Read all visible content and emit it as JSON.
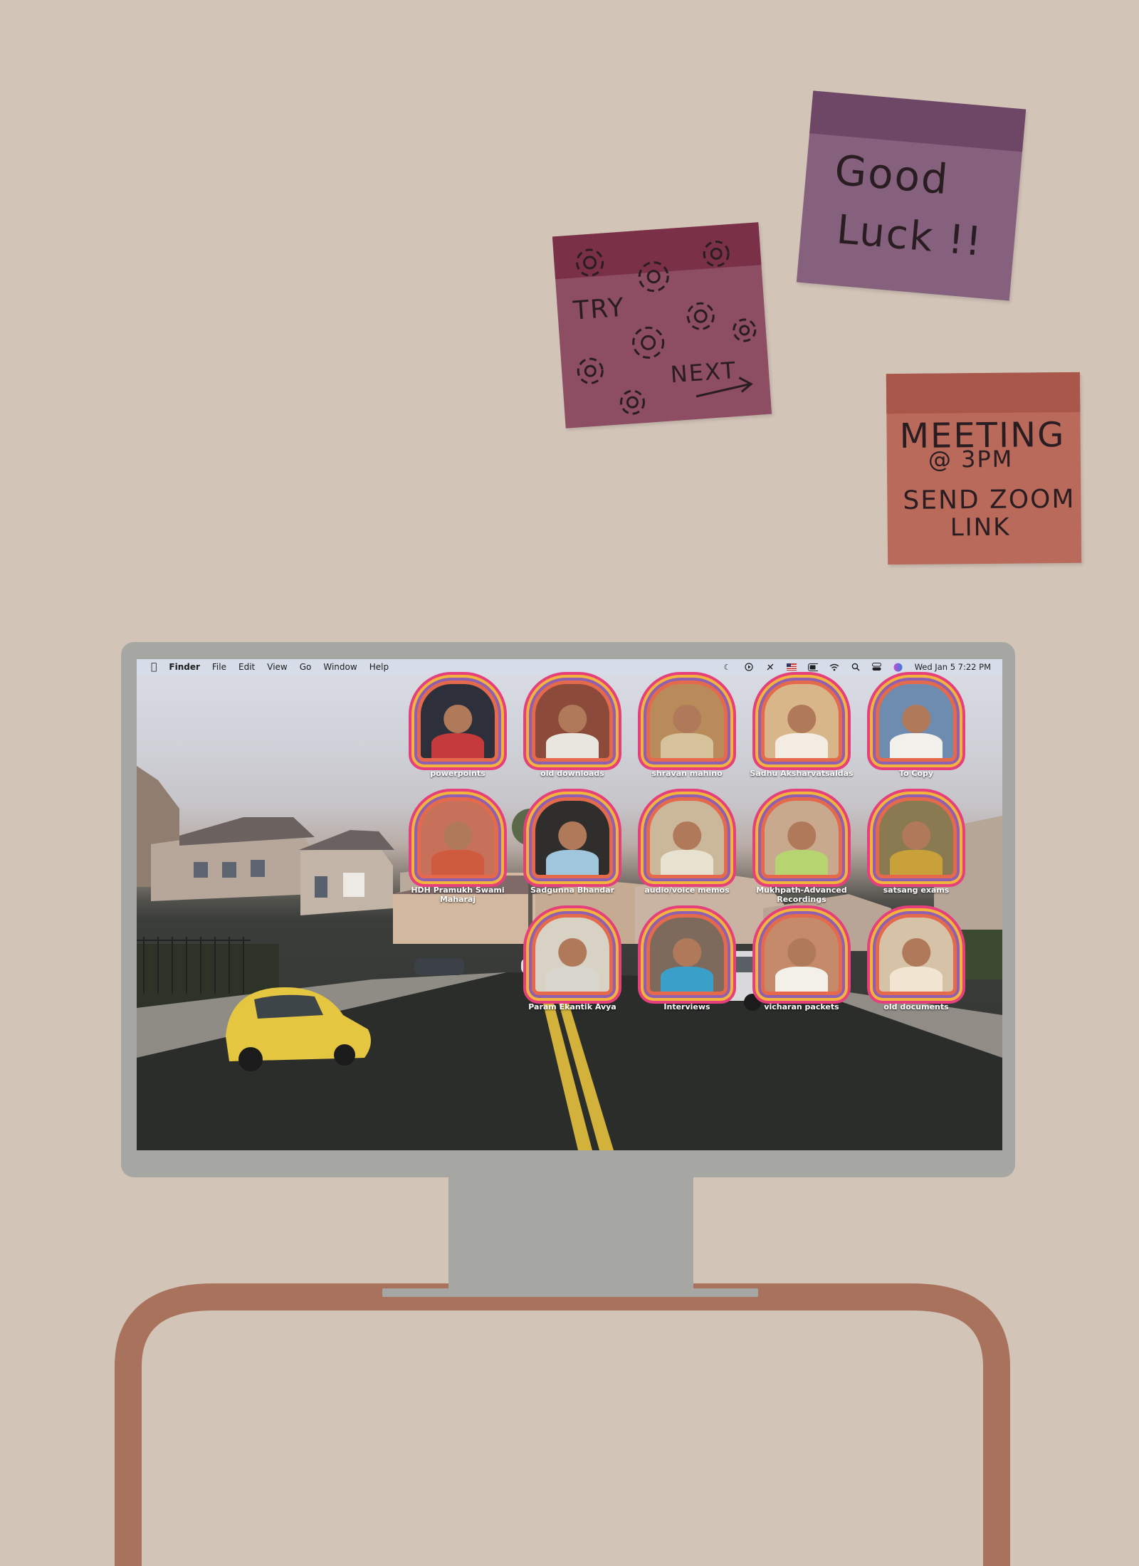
{
  "notes": {
    "try": {
      "line1": "TRY",
      "line2": "NEXT"
    },
    "luck": {
      "line1": "Good",
      "line2": "Luck !!"
    },
    "meeting": {
      "line1": "MEETING",
      "line2": "@ 3PM",
      "line3": "SEND ZOOM",
      "line4": "LINK"
    }
  },
  "menubar": {
    "apple_icon": "apple-logo-icon",
    "app_name": "Finder",
    "menus": [
      "File",
      "Edit",
      "View",
      "Go",
      "Window",
      "Help"
    ],
    "status_icons": [
      "moon-icon",
      "play-icon",
      "tool-icon",
      "us-flag-icon",
      "battery-icon",
      "wifi-icon",
      "search-icon",
      "control-center-icon",
      "siri-icon"
    ],
    "clock": "Wed Jan 5  7:22 PM"
  },
  "desktop_icons": [
    {
      "label": "powerpoints",
      "bg": "#2d2f3a",
      "shirt": "#c53b3b"
    },
    {
      "label": "old downloads",
      "bg": "#8b4a3a",
      "shirt": "#e8e6df"
    },
    {
      "label": "shravan mahino",
      "bg": "#b98a5a",
      "shirt": "#d5c29a"
    },
    {
      "label": "Sadhu Aksharvatsaldas",
      "bg": "#d9b58a",
      "shirt": "#f3ece2"
    },
    {
      "label": "To Copy",
      "bg": "#6e8bb0",
      "shirt": "#f2f0ea"
    },
    {
      "label": "HDH Pramukh Swami Maharaj",
      "bg": "#c8715a",
      "shirt": "#cf5b3e"
    },
    {
      "label": "Sadgunna Bhandar",
      "bg": "#2f2e2c",
      "shirt": "#9fc6dd"
    },
    {
      "label": "audio/voice memos",
      "bg": "#cbb79a",
      "shirt": "#e7e2cf"
    },
    {
      "label": "Mukhpath-Advanced Recordings",
      "bg": "#c9a98e",
      "shirt": "#b6d46f"
    },
    {
      "label": "satsang exams",
      "bg": "#8a7a52",
      "shirt": "#c9a13a"
    },
    {
      "label": "Param Ekantik Avya",
      "bg": "#d7d2c4",
      "shirt": "#d9d6cf"
    },
    {
      "label": "Interviews",
      "bg": "#7d6a5c",
      "shirt": "#3aa0c9"
    },
    {
      "label": "vicharan packets",
      "bg": "#c48a6a",
      "shirt": "#f3f0ea"
    },
    {
      "label": "old documents",
      "bg": "#d6c2a6",
      "shirt": "#f1e5d2"
    }
  ]
}
